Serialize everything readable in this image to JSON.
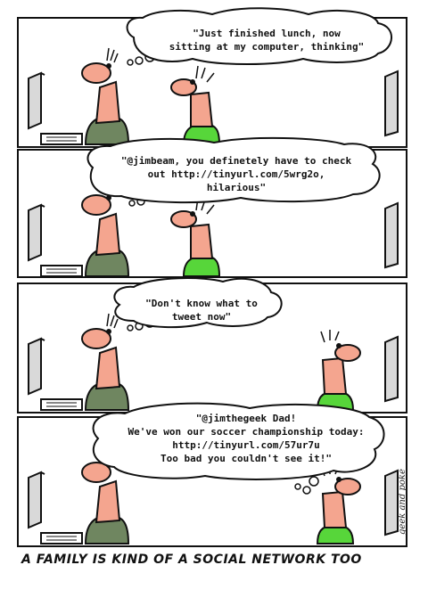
{
  "panels": [
    {
      "bubble_lines": [
        "\"Just finished lunch, now",
        "sitting at my computer, thinking\""
      ]
    },
    {
      "bubble_lines": [
        "\"@jimbeam, you definetely have to check",
        "out http://tinyurl.com/5wrg2o,",
        "hilarious\""
      ]
    },
    {
      "bubble_lines": [
        "\"Don't know what to",
        "tweet now\""
      ]
    },
    {
      "bubble_lines": [
        "\"@jimthegeek Dad!",
        "We've won our soccer championship today:",
        "http://tinyurl.com/57ur7u",
        "Too bad you couldn't see it!\""
      ]
    }
  ],
  "caption": "A FAMILY IS KIND OF A SOCIAL NETWORK TOO",
  "signature": "geek and poke",
  "colors": {
    "skin": "#f4a58f",
    "dad_shirt": "#6f8660",
    "kid_shirt": "#57d63a",
    "monitor": "#d9d9d9",
    "ink": "#111111"
  }
}
